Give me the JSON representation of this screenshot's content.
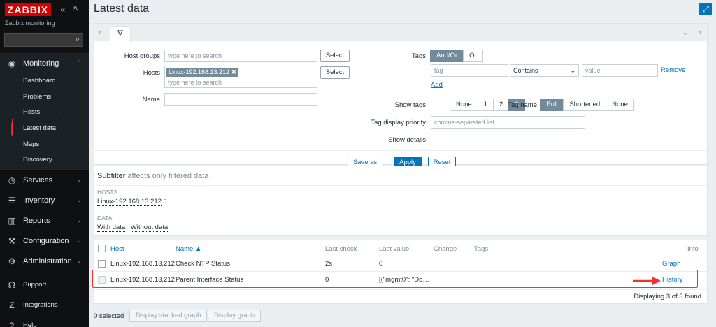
{
  "sidebar": {
    "logo": "ZABBIX",
    "subtitle": "Zabbix monitoring",
    "monitoring": "Monitoring",
    "submenu": [
      "Dashboard",
      "Problems",
      "Hosts",
      "Latest data",
      "Maps",
      "Discovery"
    ],
    "sections": [
      "Services",
      "Inventory",
      "Reports",
      "Configuration",
      "Administration"
    ],
    "lower": [
      "Support",
      "Integrations",
      "Help"
    ]
  },
  "page": {
    "title": "Latest data"
  },
  "filter": {
    "host_groups_label": "Host groups",
    "host_groups_placeholder": "type here to search",
    "hosts_label": "Hosts",
    "host_chip": "Linux-192.168.13.212",
    "hosts_placeholder": "type here to search",
    "name_label": "Name",
    "select": "Select",
    "tags_label": "Tags",
    "and_or": "And/Or",
    "or": "Or",
    "tag_placeholder": "tag",
    "contains": "Contains",
    "value_placeholder": "value",
    "remove": "Remove",
    "add": "Add",
    "show_tags_label": "Show tags",
    "show_tags_opts": [
      "None",
      "1",
      "2",
      "3"
    ],
    "tag_name_label": "Tag name",
    "tag_name_opts": [
      "Full",
      "Shortened",
      "None"
    ],
    "tag_priority_label": "Tag display priority",
    "tag_priority_placeholder": "comma-separated list",
    "show_details_label": "Show details",
    "save_as": "Save as",
    "apply": "Apply",
    "reset": "Reset"
  },
  "subfilter": {
    "title": "Subfilter",
    "note": "affects only filtered data",
    "hosts_header": "HOSTS",
    "host_item": "Linux-192.168.13.212",
    "host_count": "3",
    "data_header": "DATA",
    "with_data": "With data",
    "without_data": "Without data"
  },
  "table": {
    "headers": {
      "host": "Host",
      "name": "Name ▲",
      "last_check": "Last check",
      "last_value": "Last value",
      "change": "Change",
      "tags": "Tags",
      "info": "Info"
    },
    "rows": [
      {
        "host": "Linux-192.168.13.212",
        "name": "Check NTP Status",
        "last_check": "2s",
        "last_value": "0",
        "action": "Graph"
      },
      {
        "host": "Linux-192.168.13.212",
        "name": "Parent Interface Status",
        "last_check": "0",
        "last_value": "[{\"mgmt0\": \"Do…",
        "action": "History"
      }
    ],
    "footer": "Displaying 3 of 3 found"
  },
  "bottom": {
    "selected": "0 selected",
    "stacked": "Display stacked graph",
    "graph": "Display graph"
  },
  "colors": {
    "accent": "#0275b8",
    "logo": "#d40000",
    "highlight": "#e33333"
  }
}
